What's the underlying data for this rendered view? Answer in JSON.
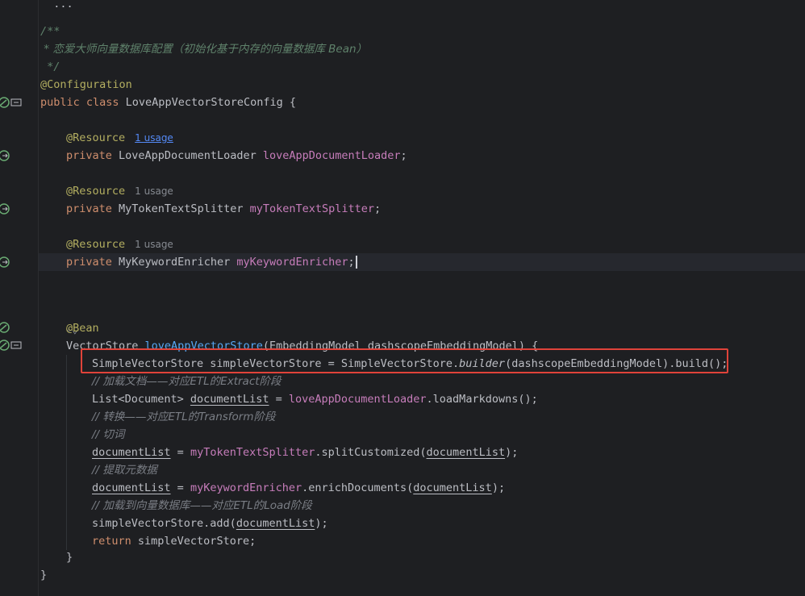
{
  "editor": {
    "lines": {
      "doc_open": "/**",
      "doc_text": " * 恋爱大师向量数据库配置（初始化基于内存的向量数据库 Bean）",
      "doc_close": " */",
      "ann_config": "@Configuration",
      "class_decl_kw": "public class ",
      "class_decl_name": "LoveAppVectorStoreConfig {",
      "ann_resource": "@Resource",
      "usage_1": "1 usage",
      "field1_kw": "private ",
      "field1_type": "LoveAppDocumentLoader ",
      "field1_name": "loveAppDocumentLoader",
      "field2_type": "MyTokenTextSplitter ",
      "field2_name": "myTokenTextSplitter",
      "field3_type": "MyKeywordEnricher ",
      "field3_name": "myKeywordEnricher",
      "semicolon": ";",
      "ann_bean": "@Bean",
      "method_ret": "VectorStore ",
      "method_name": "loveAppVectorStore",
      "method_params": "(EmbeddingModel dashscopeEmbeddingModel) {",
      "stmt1_a": "SimpleVectorStore simpleVectorStore = SimpleVectorStore.",
      "stmt1_b": "builder",
      "stmt1_c": "(dashscopeEmbeddingModel).build();",
      "cmt1": "// 加载文档——对应ETL的Extract阶段",
      "stmt2_a": "List<Document> ",
      "stmt2_b": "documentList",
      "stmt2_c": " = ",
      "stmt2_d": "loveAppDocumentLoader",
      "stmt2_e": ".loadMarkdowns();",
      "cmt2": "// 转换——对应ETL的Transform阶段",
      "cmt3": "// 切词",
      "stmt3_a": "documentList",
      "stmt3_b": " = ",
      "stmt3_c": "myTokenTextSplitter",
      "stmt3_d": ".splitCustomized(",
      "stmt3_e": "documentList",
      "stmt3_f": ");",
      "cmt4": "// 提取元数据",
      "stmt4_c": "myKeywordEnricher",
      "stmt4_d": ".enrichDocuments(",
      "cmt5": "// 加载到向量数据库——对应ETL的Load阶段",
      "stmt5_a": "simpleVectorStore.add(",
      "stmt5_c": ");",
      "ret_kw": "return ",
      "ret_val": "simpleVectorStore;",
      "close_method": "}",
      "close_class": "}"
    }
  }
}
